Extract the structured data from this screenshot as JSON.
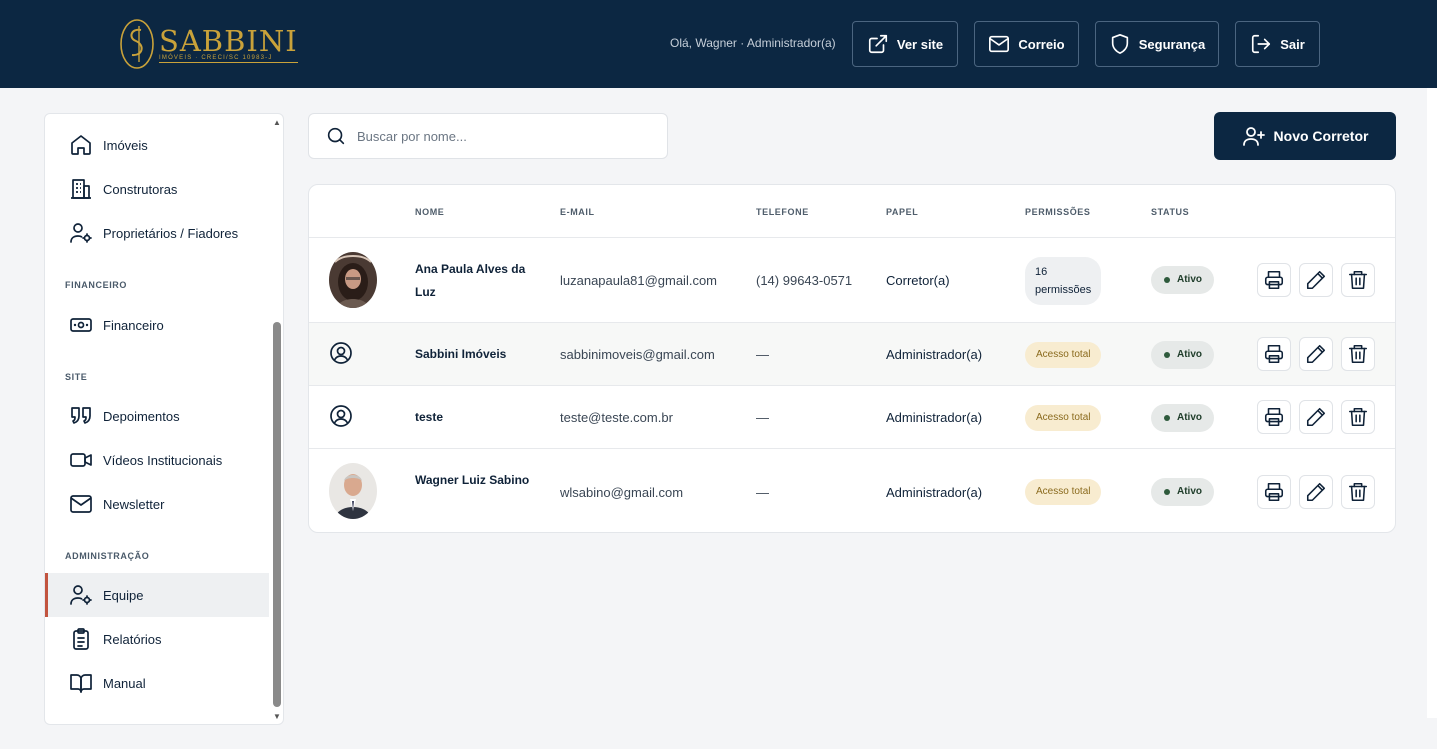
{
  "header": {
    "brand": "SABBINI",
    "brand_sub": "IMÓVEIS · CRECI/SC 10983-J",
    "greeting": "Olá, Wagner · Administrador(a)",
    "buttons": {
      "site": "Ver site",
      "mail": "Correio",
      "security": "Segurança",
      "logout": "Sair"
    }
  },
  "sidebar": {
    "items": {
      "imoveis": "Imóveis",
      "construtoras": "Construtoras",
      "proprietarios": "Proprietários / Fiadores",
      "financeiro": "Financeiro",
      "depoimentos": "Depoimentos",
      "videos": "Vídeos Institucionais",
      "newsletter": "Newsletter",
      "equipe": "Equipe",
      "relatorios": "Relatórios",
      "manual": "Manual"
    },
    "sections": {
      "financeiro": "FINANCEIRO",
      "site": "SITE",
      "administracao": "ADMINISTRAÇÃO"
    }
  },
  "search": {
    "placeholder": "Buscar por nome..."
  },
  "new_button": "Novo Corretor",
  "table": {
    "headers": {
      "nome": "NOME",
      "email": "E-MAIL",
      "telefone": "TELEFONE",
      "papel": "PAPEL",
      "permissoes": "PERMISSÕES",
      "status": "STATUS"
    },
    "rows": [
      {
        "name": "Ana Paula Alves da Luz",
        "email": "luzanapaula81@gmail.com",
        "phone": "(14) 99643-0571",
        "role": "Corretor(a)",
        "perm_count": "16",
        "perm_word": "permissões",
        "status": "Ativo"
      },
      {
        "name": "Sabbini Imóveis",
        "email": "sabbinimoveis@gmail.com",
        "phone": "—",
        "role": "Administrador(a)",
        "perm": "Acesso total",
        "status": "Ativo"
      },
      {
        "name": "teste",
        "email": "teste@teste.com.br",
        "phone": "—",
        "role": "Administrador(a)",
        "perm": "Acesso total",
        "status": "Ativo"
      },
      {
        "name": "Wagner Luiz Sabino",
        "email": "wlsabino@gmail.com",
        "phone": "—",
        "role": "Administrador(a)",
        "perm": "Acesso total",
        "status": "Ativo"
      }
    ]
  },
  "colors": {
    "navy": "#0c2742",
    "gold": "#c9a23a",
    "active_accent": "#c2543f"
  }
}
